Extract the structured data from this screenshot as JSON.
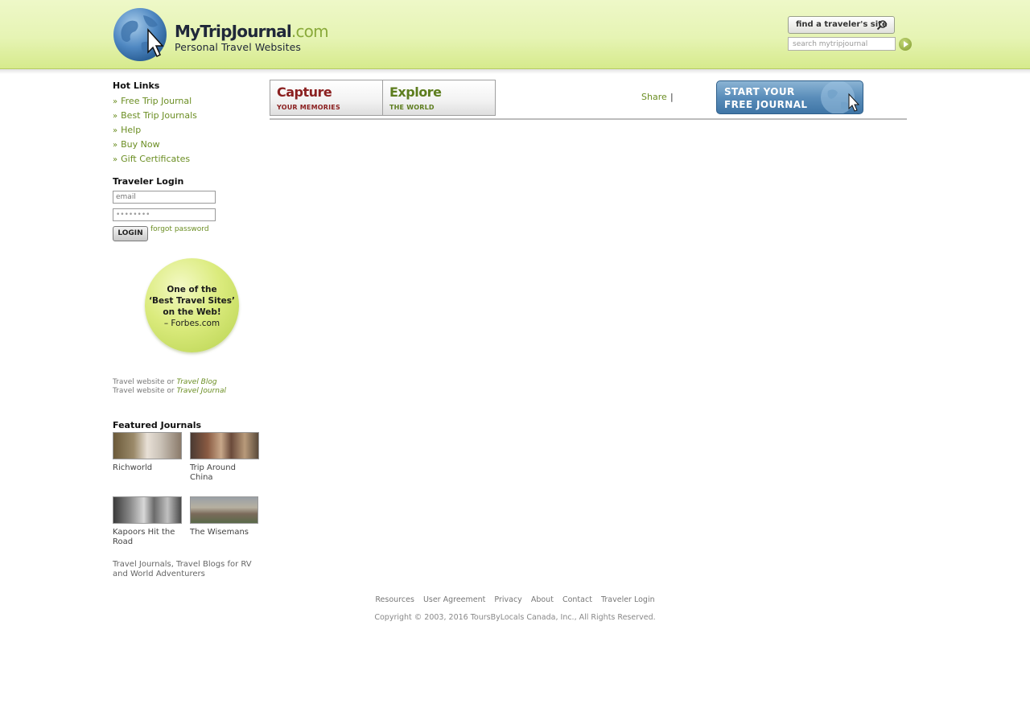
{
  "header": {
    "logo_name": "MyTripJournal",
    "logo_domain": ".com",
    "tagline": "Personal Travel Websites",
    "find_label": "find a traveler's site",
    "search_placeholder": "search mytripjournal"
  },
  "sidebar": {
    "hot_links_title": "Hot Links",
    "hot_links": [
      "Free Trip Journal",
      "Best Trip Journals",
      "Help",
      "Buy Now",
      "Gift Certificates"
    ],
    "login_title": "Traveler Login",
    "email_placeholder": "email",
    "password_value": "••••••••",
    "login_button": "LOGIN",
    "forgot_link": "forgot password",
    "badge_line1": "One of the",
    "badge_line2": "‘Best Travel Sites’",
    "badge_line3": "on the Web!",
    "badge_line4": "– Forbes.com",
    "travel_prefix": "Travel website or",
    "travel_link1": "Travel Blog",
    "travel_link2": "Travel Journal",
    "featured_title": "Featured Journals",
    "featured": [
      {
        "caption": "Richworld"
      },
      {
        "caption": "Trip Around China"
      },
      {
        "caption": "Kapoors Hit the Road"
      },
      {
        "caption": "The Wisemans"
      }
    ],
    "featured_desc": "Travel Journals, Travel Blogs for RV and World Adventurers"
  },
  "topbar": {
    "capture_big": "Capture",
    "capture_small": "YOUR MEMORIES",
    "explore_big": "Explore",
    "explore_small": "THE WORLD",
    "share": "Share",
    "share_sep": "|",
    "start_line1": "START YOUR",
    "start_line2": "FREE JOURNAL"
  },
  "footer": {
    "links": [
      "Resources",
      "User Agreement",
      "Privacy",
      "About",
      "Contact",
      "Traveler Login"
    ],
    "copyright": "Copyright © 2003, 2016  ToursByLocals Canada, Inc., All Rights Reserved."
  },
  "colors": {
    "accent_green": "#6b8e23",
    "header_green": "#e6f4b4",
    "capture_red": "#8b2020",
    "start_blue": "#5a8dba"
  }
}
